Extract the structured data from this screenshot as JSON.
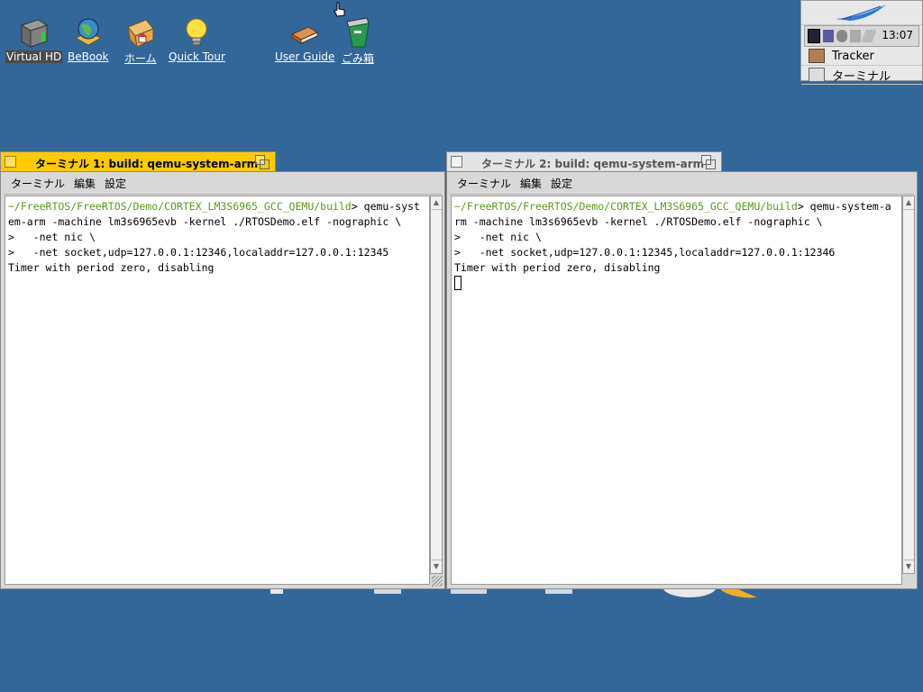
{
  "desktop": {
    "icons": [
      {
        "label": "Virtual HD",
        "icon": "hard-disk-icon"
      },
      {
        "label": "BeBook",
        "icon": "bebook-icon"
      },
      {
        "label": "ホーム",
        "icon": "home-folder-icon"
      },
      {
        "label": "Quick Tour",
        "icon": "lightbulb-icon"
      },
      {
        "label": "User Guide",
        "icon": "book-icon"
      },
      {
        "label": "ごみ箱",
        "icon": "trash-icon"
      }
    ]
  },
  "deskbar": {
    "clock": "13:07",
    "items": [
      {
        "label": "Tracker",
        "icon": "tracker-icon"
      },
      {
        "label": "ターミナル",
        "icon": "terminal-icon"
      }
    ]
  },
  "terminal1": {
    "title": "ターミナル 1: build: qemu-system-arm",
    "menus": [
      "ターミナル",
      "編集",
      "設定"
    ],
    "prompt_path": "~/FreeRTOS/FreeRTOS/Demo/CORTEX_LM3S6965_GCC_QEMU/build",
    "line1_cmd": "> qemu-syst",
    "line2": "em-arm -machine lm3s6965evb -kernel ./RTOSDemo.elf -nographic \\",
    "line3": ">   -net nic \\",
    "line4": ">   -net socket,udp=127.0.0.1:12346,localaddr=127.0.0.1:12345",
    "line5": "Timer with period zero, disabling"
  },
  "terminal2": {
    "title": "ターミナル 2: build: qemu-system-arm",
    "menus": [
      "ターミナル",
      "編集",
      "設定"
    ],
    "prompt_path": "~/FreeRTOS/FreeRTOS/Demo/CORTEX_LM3S6965_GCC_QEMU/build",
    "line1_cmd": "> qemu-system-a",
    "line2": "rm -machine lm3s6965evb -kernel ./RTOSDemo.elf -nographic \\",
    "line3": ">   -net nic \\",
    "line4": ">   -net socket,udp=127.0.0.1:12345,localaddr=127.0.0.1:12346",
    "line5": "Timer with period zero, disabling"
  },
  "colors": {
    "desktop": "#336699",
    "active_tab": "#ffcb00",
    "prompt_path": "#5a9a1a"
  }
}
